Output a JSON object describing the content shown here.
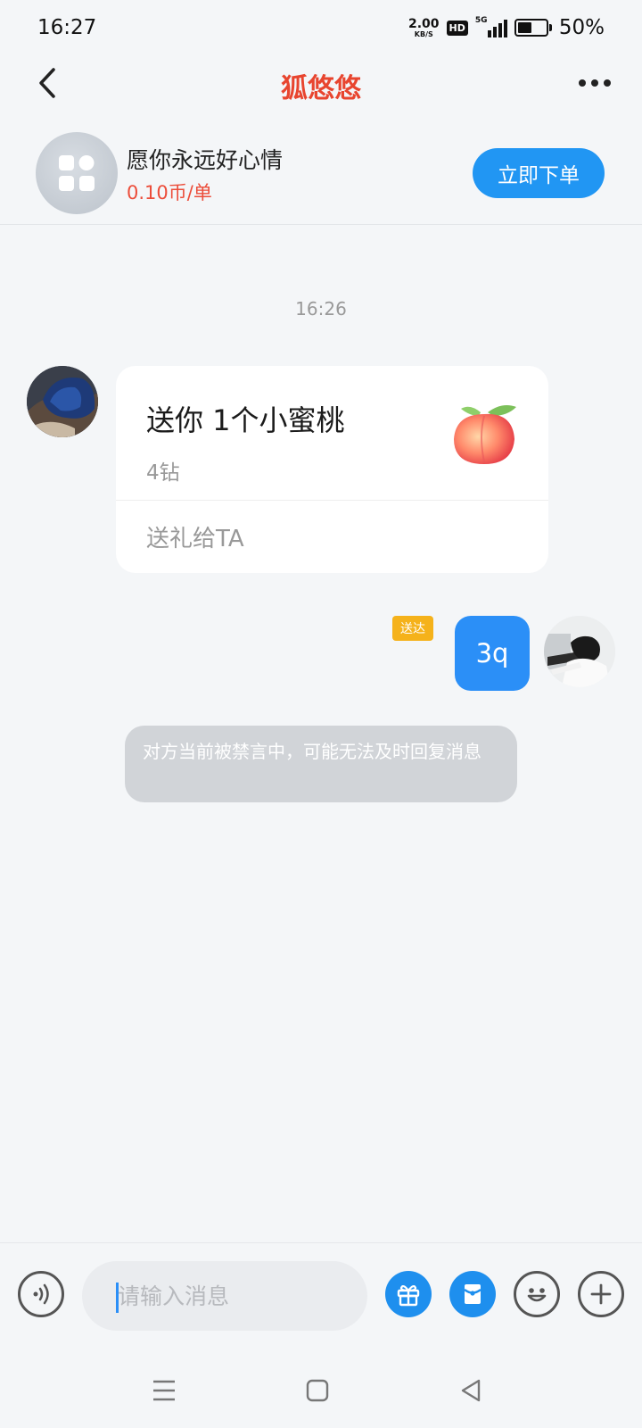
{
  "status_bar": {
    "time": "16:27",
    "net_speed": "2.00",
    "net_unit": "KB/S",
    "hd": "HD",
    "network": "5G",
    "battery_percent": "50%",
    "battery_level": 0.5
  },
  "header": {
    "title": "狐悠悠",
    "back_icon": "chevron-left-icon",
    "more_icon": "more-dots-icon"
  },
  "service": {
    "name": "愿你永远好心情",
    "price": "0.10币/单",
    "order_button": "立即下单",
    "avatar_icon": "grid-apps-icon"
  },
  "chat": {
    "timestamp": "16:26",
    "gift_message": {
      "title": "送你 1个小蜜桃",
      "price": "4钻",
      "action": "送礼给TA",
      "icon": "peach-icon"
    },
    "outgoing": {
      "status": "送达",
      "text": "3q"
    },
    "system_notice": "对方当前被禁言中，可能无法及时回复消息"
  },
  "input_bar": {
    "placeholder": "请输入消息",
    "voice_icon": "voice-icon",
    "gift_icon": "gift-icon",
    "envelope_icon": "red-envelope-icon",
    "emoji_icon": "emoji-icon",
    "plus_icon": "plus-icon"
  },
  "nav_bar": {
    "menu_icon": "menu-icon",
    "home_icon": "home-square-icon",
    "back_icon": "back-triangle-icon"
  },
  "colors": {
    "title": "#e8452f",
    "price": "#ec4d3a",
    "primary": "#2196f3",
    "bubble": "#2b8ff7",
    "badge": "#f5b21b",
    "background": "#f4f6f8"
  }
}
